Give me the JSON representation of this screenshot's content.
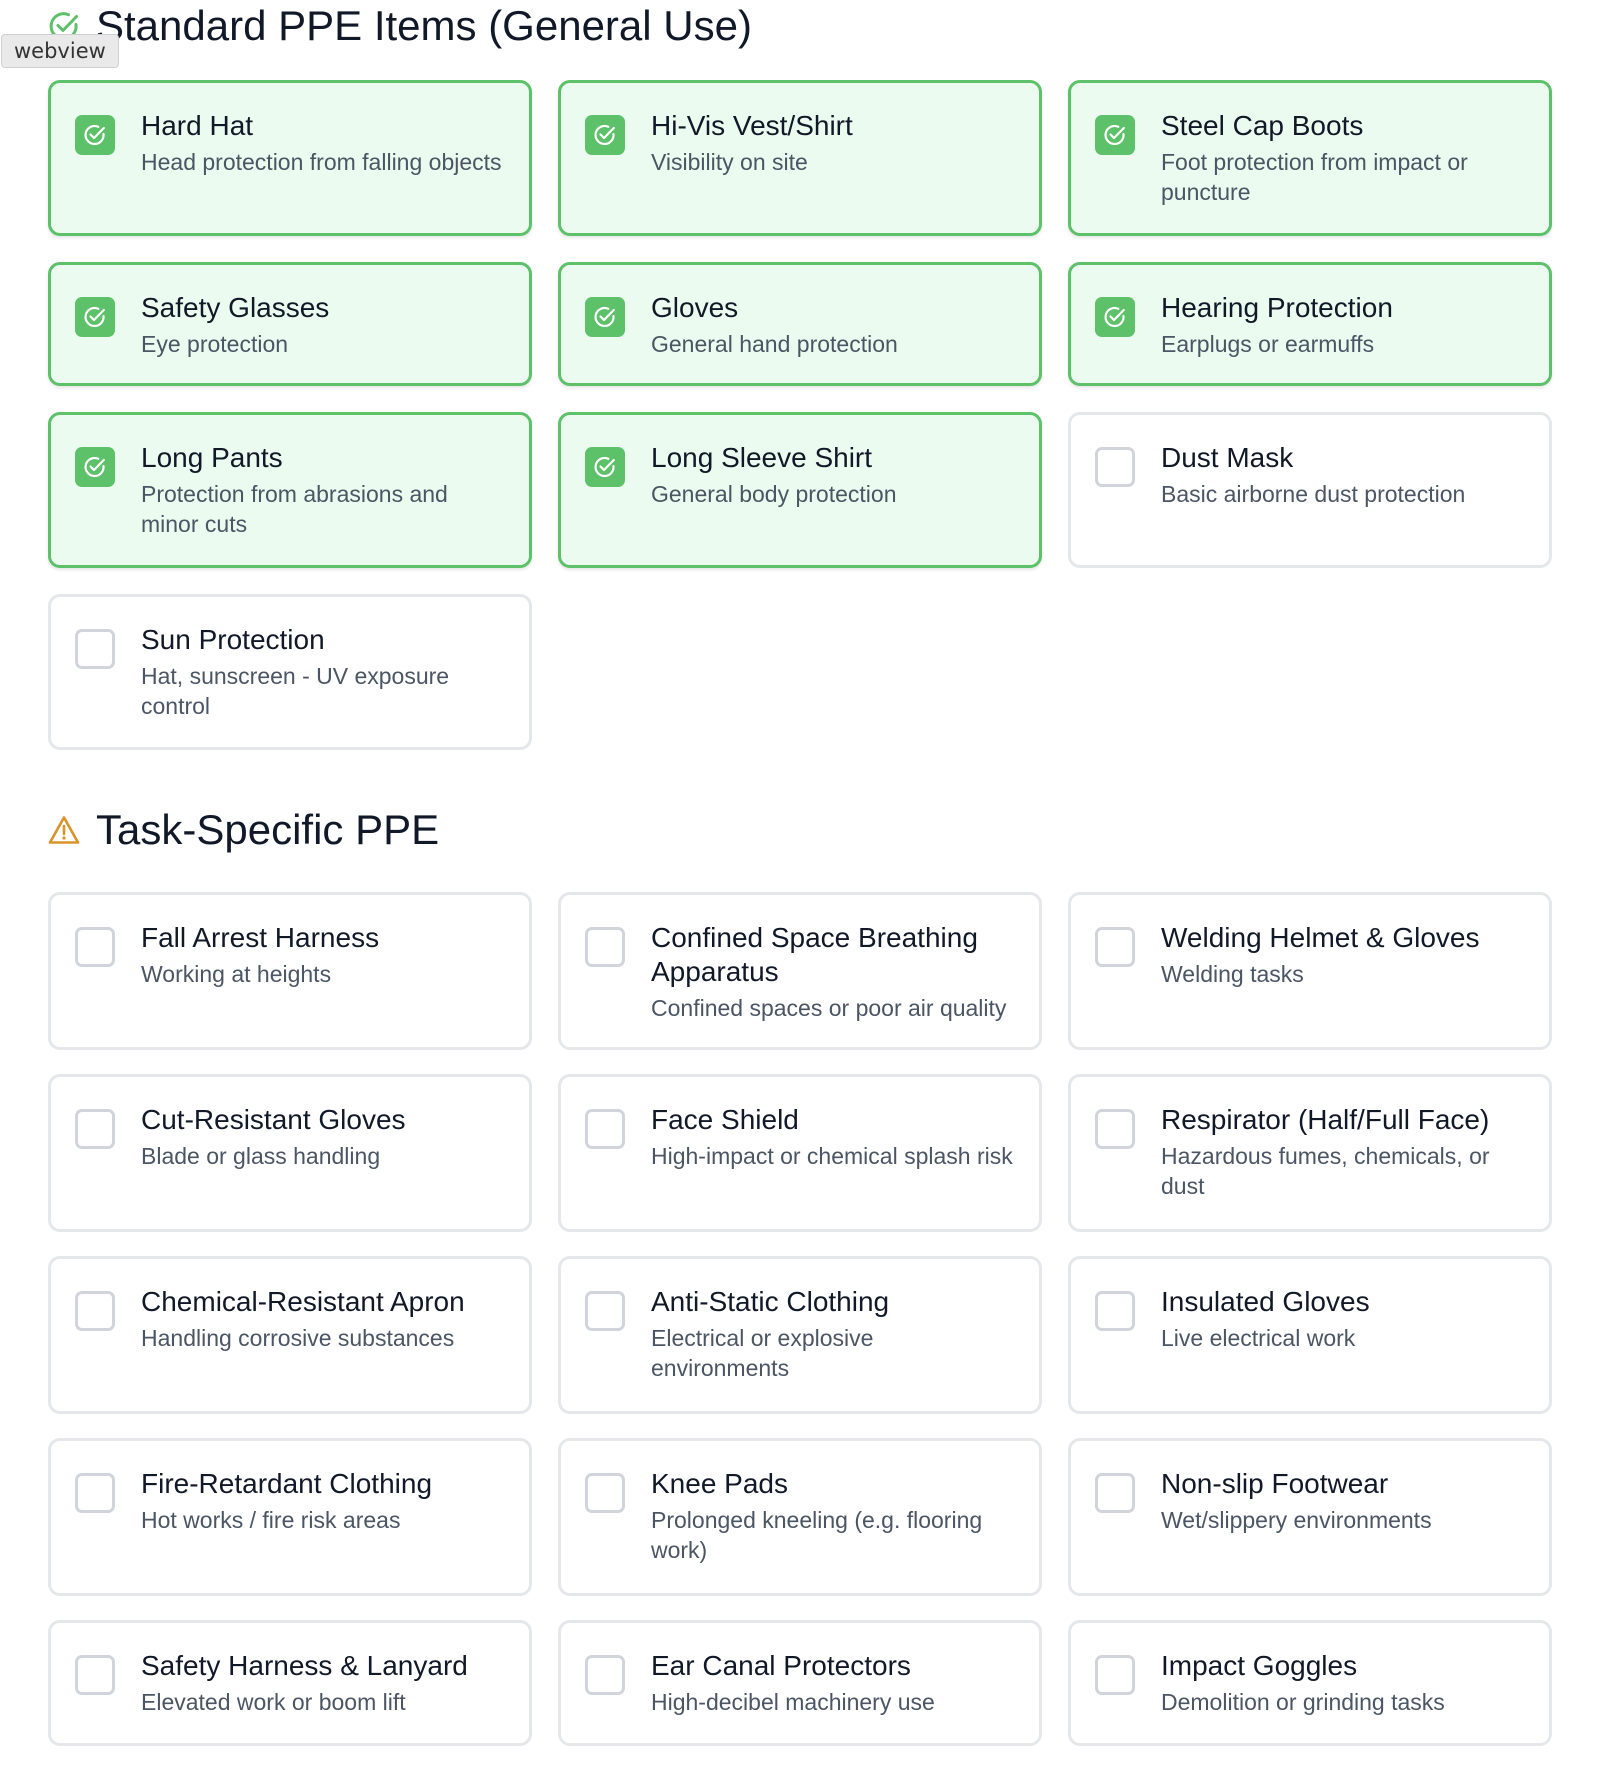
{
  "tooltip": "webview",
  "sections": [
    {
      "title": "Standard PPE Items (General Use)",
      "icon": "check-circle-icon",
      "items": [
        {
          "label": "Hard Hat",
          "desc": "Head protection from falling objects",
          "checked": true
        },
        {
          "label": "Hi-Vis Vest/Shirt",
          "desc": "Visibility on site",
          "checked": true
        },
        {
          "label": "Steel Cap Boots",
          "desc": "Foot protection from impact or puncture",
          "checked": true
        },
        {
          "label": "Safety Glasses",
          "desc": "Eye protection",
          "checked": true
        },
        {
          "label": "Gloves",
          "desc": "General hand protection",
          "checked": true
        },
        {
          "label": "Hearing Protection",
          "desc": "Earplugs or earmuffs",
          "checked": true
        },
        {
          "label": "Long Pants",
          "desc": "Protection from abrasions and minor cuts",
          "checked": true
        },
        {
          "label": "Long Sleeve Shirt",
          "desc": "General body protection",
          "checked": true
        },
        {
          "label": "Dust Mask",
          "desc": "Basic airborne dust protection",
          "checked": false
        },
        {
          "label": "Sun Protection",
          "desc": "Hat, sunscreen - UV exposure control",
          "checked": false
        }
      ]
    },
    {
      "title": "Task-Specific PPE",
      "icon": "warning-triangle-icon",
      "items": [
        {
          "label": "Fall Arrest Harness",
          "desc": "Working at heights",
          "checked": false
        },
        {
          "label": "Confined Space Breathing Apparatus",
          "desc": "Confined spaces or poor air quality",
          "checked": false
        },
        {
          "label": "Welding Helmet & Gloves",
          "desc": "Welding tasks",
          "checked": false
        },
        {
          "label": "Cut-Resistant Gloves",
          "desc": "Blade or glass handling",
          "checked": false
        },
        {
          "label": "Face Shield",
          "desc": "High-impact or chemical splash risk",
          "checked": false
        },
        {
          "label": "Respirator (Half/Full Face)",
          "desc": "Hazardous fumes, chemicals, or dust",
          "checked": false
        },
        {
          "label": "Chemical-Resistant Apron",
          "desc": "Handling corrosive substances",
          "checked": false
        },
        {
          "label": "Anti-Static Clothing",
          "desc": "Electrical or explosive environments",
          "checked": false
        },
        {
          "label": "Insulated Gloves",
          "desc": "Live electrical work",
          "checked": false
        },
        {
          "label": "Fire-Retardant Clothing",
          "desc": "Hot works / fire risk areas",
          "checked": false
        },
        {
          "label": "Knee Pads",
          "desc": "Prolonged kneeling (e.g. flooring work)",
          "checked": false
        },
        {
          "label": "Non-slip Footwear",
          "desc": "Wet/slippery environments",
          "checked": false
        },
        {
          "label": "Safety Harness & Lanyard",
          "desc": "Elevated work or boom lift",
          "checked": false
        },
        {
          "label": "Ear Canal Protectors",
          "desc": "High-decibel machinery use",
          "checked": false
        },
        {
          "label": "Impact Goggles",
          "desc": "Demolition or grinding tasks",
          "checked": false
        }
      ]
    }
  ],
  "colors": {
    "checked_border": "#5cc168",
    "checked_bg": "#ecfbef",
    "warning": "#d9932b",
    "check_icon": "#5cc168"
  }
}
